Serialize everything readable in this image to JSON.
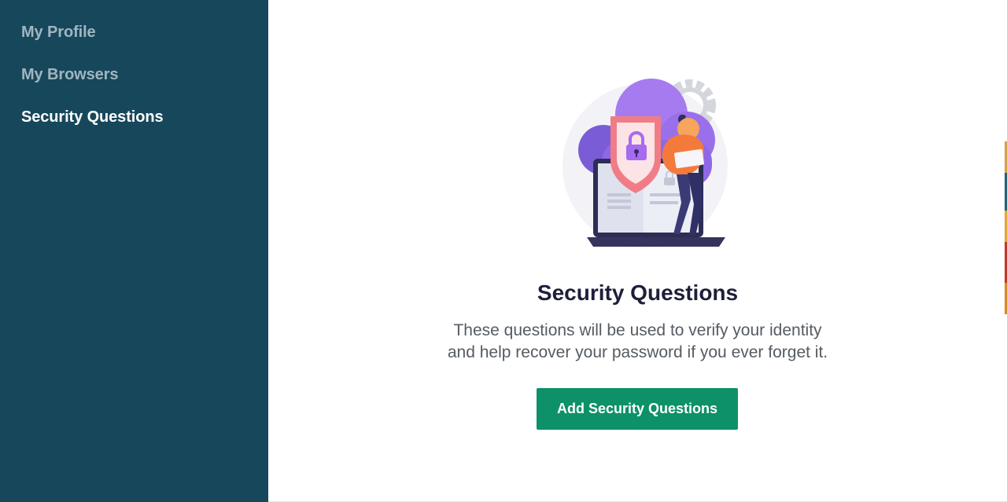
{
  "sidebar": {
    "items": [
      {
        "label": "My Profile",
        "active": false
      },
      {
        "label": "My Browsers",
        "active": false
      },
      {
        "label": "Security Questions",
        "active": true
      }
    ]
  },
  "main": {
    "title": "Security Questions",
    "description_line1": "These questions will be used to verify your identity",
    "description_line2": "and help recover your password if you ever forget it.",
    "button_label": "Add Security Questions"
  },
  "colors": {
    "sidebar_bg": "#17475b",
    "sidebar_text": "#9fb6c1",
    "sidebar_text_active": "#ffffff",
    "button_bg": "#0d9168",
    "title_text": "#1d1f3a",
    "body_text": "#555b62"
  },
  "icons": {
    "illustration": "security-lock-cloud-illustration"
  }
}
